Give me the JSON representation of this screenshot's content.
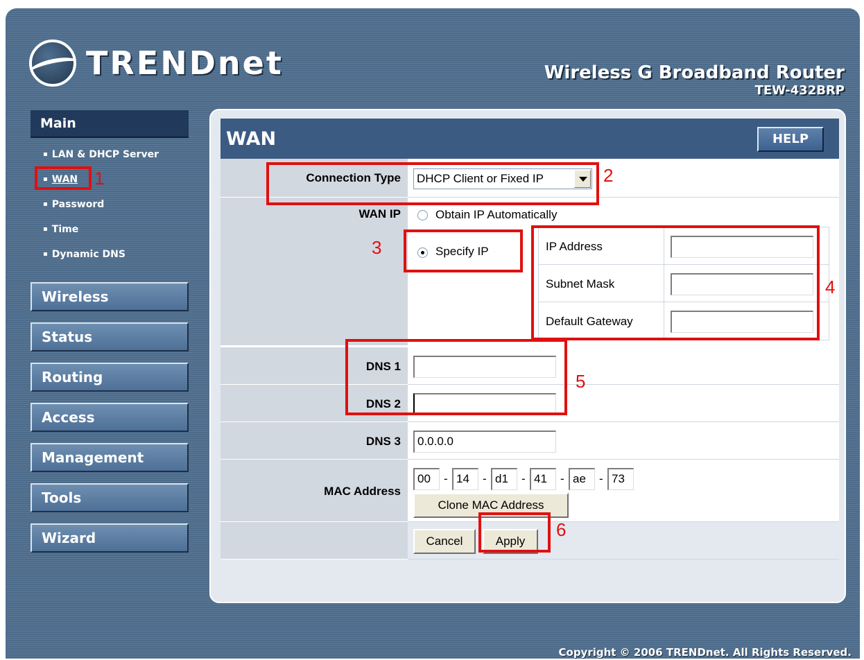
{
  "brand": {
    "logo_text": "TRENDnet",
    "product_name": "Wireless G Broadband Router",
    "model": "TEW-432BRP"
  },
  "sidebar": {
    "main_label": "Main",
    "main_items": [
      {
        "label": "LAN & DHCP Server",
        "active": false
      },
      {
        "label": "WAN",
        "active": true
      },
      {
        "label": "Password",
        "active": false
      },
      {
        "label": "Time",
        "active": false
      },
      {
        "label": "Dynamic DNS",
        "active": false
      }
    ],
    "sections": [
      "Wireless",
      "Status",
      "Routing",
      "Access",
      "Management",
      "Tools",
      "Wizard"
    ]
  },
  "page": {
    "title": "WAN",
    "help_label": "HELP"
  },
  "form": {
    "connection_type": {
      "label": "Connection Type",
      "value": "DHCP Client or Fixed IP"
    },
    "wan_ip": {
      "label": "WAN IP",
      "option_auto": "Obtain IP Automatically",
      "option_specify": "Specify IP",
      "selected": "specify"
    },
    "ip_fields": {
      "ip_address_label": "IP Address",
      "ip_address_value": "",
      "subnet_mask_label": "Subnet Mask",
      "subnet_mask_value": "",
      "default_gateway_label": "Default Gateway",
      "default_gateway_value": ""
    },
    "dns": {
      "dns1_label": "DNS 1",
      "dns1_value": "",
      "dns2_label": "DNS 2",
      "dns2_value": "",
      "dns3_label": "DNS 3",
      "dns3_value": "0.0.0.0"
    },
    "mac": {
      "label": "MAC Address",
      "octets": [
        "00",
        "14",
        "d1",
        "41",
        "ae",
        "73"
      ],
      "separator": "-",
      "clone_label": "Clone MAC Address"
    },
    "actions": {
      "cancel_label": "Cancel",
      "apply_label": "Apply"
    }
  },
  "annotations": [
    "1",
    "2",
    "3",
    "4",
    "5",
    "6"
  ],
  "footer": {
    "copyright": "Copyright © 2006 TRENDnet. All Rights Reserved."
  },
  "colors": {
    "annotation_red": "#e01010",
    "title_bar": "#3b5b82",
    "nav_blue": "#4e7097"
  }
}
